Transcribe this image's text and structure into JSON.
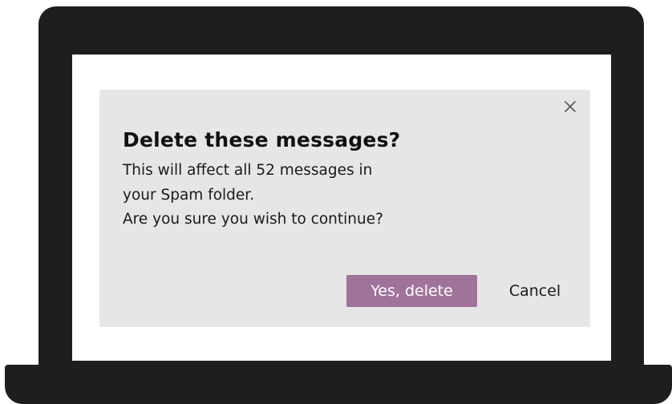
{
  "dialog": {
    "title": "Delete these messages?",
    "body_lines": [
      "This will affect all 52 messages in",
      "your Spam folder.",
      "Are you sure you wish to continue?"
    ],
    "close_icon": "close-icon",
    "confirm_label": "Yes, delete",
    "cancel_label": "Cancel"
  },
  "colors": {
    "laptop": "#1e1e1c",
    "screen": "#ffffff",
    "dialog_background": "#e6e6e6",
    "confirm_button": "#a0739a",
    "confirm_text": "#ffffff",
    "text": "#111111"
  }
}
